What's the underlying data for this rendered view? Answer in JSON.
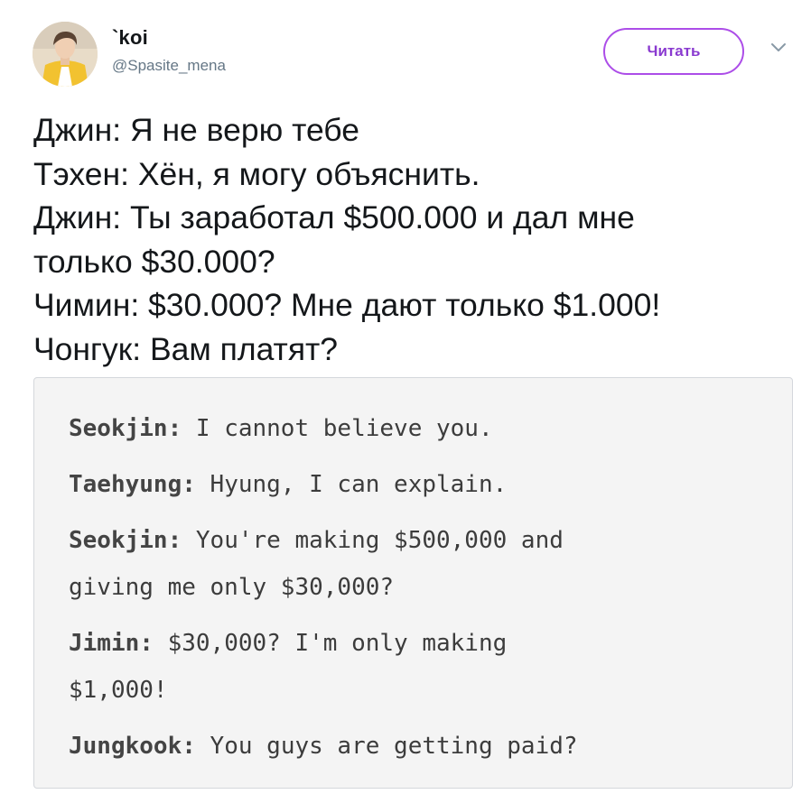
{
  "user": {
    "display_name": "`koi",
    "handle": "@Spasite_mena",
    "avatar_desc": "profile-photo"
  },
  "actions": {
    "follow_label": "Читать",
    "menu_icon": "chevron-down-icon"
  },
  "tweet": {
    "lines": [
      "Джин: Я не верю тебе",
      "Тэхен: Хён, я могу объяснить.",
      "Джин: Ты заработал $500.000 и дал мне",
      "только $30.000?",
      "Чимин: $30.000? Мне дают только $1.000!",
      "Чонгук: Вам платят?"
    ]
  },
  "media": {
    "dialogue": [
      {
        "speaker": "Seokjin:",
        "lines": [
          "I cannot believe you."
        ]
      },
      {
        "speaker": "Taehyung:",
        "lines": [
          "Hyung, I can explain."
        ]
      },
      {
        "speaker": "Seokjin:",
        "lines": [
          "You're making $500,000 and",
          "giving me only $30,000?"
        ]
      },
      {
        "speaker": "Jimin:",
        "lines": [
          "$30,000? I'm only making",
          "$1,000!"
        ]
      },
      {
        "speaker": "Jungkook:",
        "lines": [
          "You guys are getting paid?"
        ]
      }
    ]
  },
  "colors": {
    "follow_accent": "#ac4de8",
    "text": "#14171a",
    "secondary": "#657786",
    "card_bg": "#f4f4f4"
  }
}
